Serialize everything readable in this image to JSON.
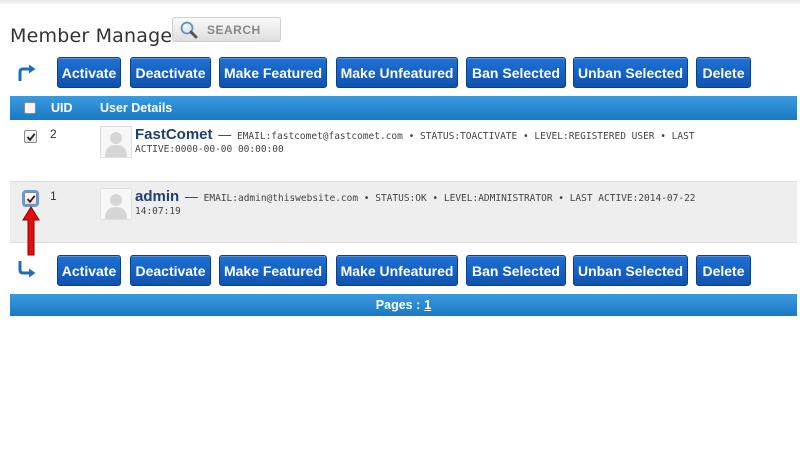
{
  "page": {
    "title": "Member Manager"
  },
  "search": {
    "label": "SEARCH"
  },
  "actions": [
    "Activate",
    "Deactivate",
    "Make Featured",
    "Make Unfeatured",
    "Ban Selected",
    "Unban Selected",
    "Delete"
  ],
  "table": {
    "headers": {
      "uid": "UID",
      "details": "User Details"
    },
    "rows": [
      {
        "uid": "2",
        "username": "FastComet",
        "dash": "—",
        "meta": "EMAIL:fastcomet@fastcomet.com • STATUS:TOACTIVATE • LEVEL:REGISTERED USER • LAST ACTIVE:0000-00-00 00:00:00",
        "checked": true
      },
      {
        "uid": "1",
        "username": "admin",
        "dash": "—",
        "meta": "EMAIL:admin@thiswebsite.com • STATUS:OK • LEVEL:ADMINISTRATOR • LAST ACTIVE:2014-07-22 14:07:19",
        "checked": true
      }
    ]
  },
  "pagination": {
    "label": "Pages :",
    "current": "1"
  },
  "colors": {
    "button_blue": "#1565c8",
    "header_blue": "#2a8ad4",
    "annotation_red": "#e01010"
  },
  "icons": [
    "search-icon",
    "select-arrow-icon",
    "user-avatar-icon",
    "checkmark-icon",
    "red-arrow-annotation"
  ]
}
